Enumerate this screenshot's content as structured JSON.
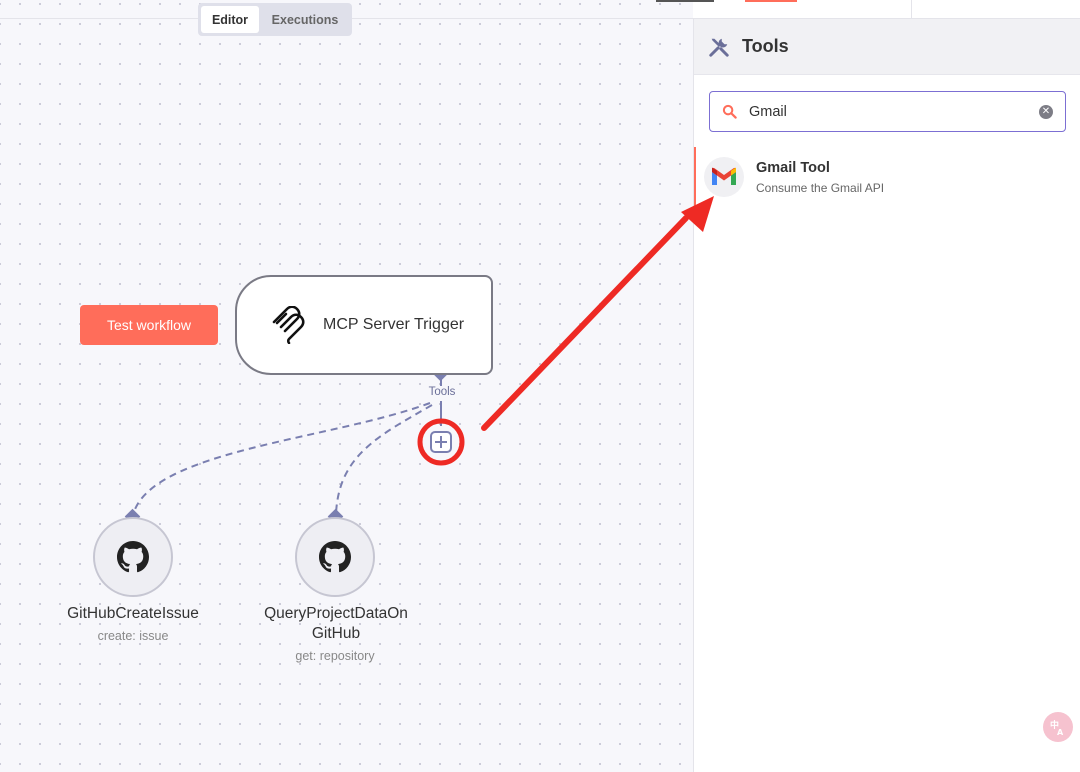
{
  "topbar": {
    "tabs": [
      {
        "label": "Editor",
        "active": true
      },
      {
        "label": "Executions",
        "active": false
      }
    ]
  },
  "canvas": {
    "test_button": "Test workflow",
    "trigger_node": {
      "title": "MCP Server Trigger",
      "icon": "mcp-icon"
    },
    "connector_label": "Tools",
    "add_tool_icon": "plus-square-icon",
    "tool_nodes": [
      {
        "title": "GitHubCreateIssue",
        "subtitle": "create: issue",
        "icon": "github-icon"
      },
      {
        "title": "QueryProjectDataOn GitHub",
        "subtitle": "get: repository",
        "icon": "github-icon"
      }
    ]
  },
  "panel": {
    "title": "Tools",
    "icon": "wrench-screwdriver-icon",
    "search": {
      "value": "Gmail",
      "placeholder": ""
    },
    "results": [
      {
        "title": "Gmail Tool",
        "description": "Consume the Gmail API",
        "icon": "gmail-icon"
      }
    ]
  },
  "colors": {
    "accent": "#ff6d5a",
    "connector": "#7a7fb0",
    "annotation": "#ee2a24",
    "search_border": "#7c6fd3"
  }
}
